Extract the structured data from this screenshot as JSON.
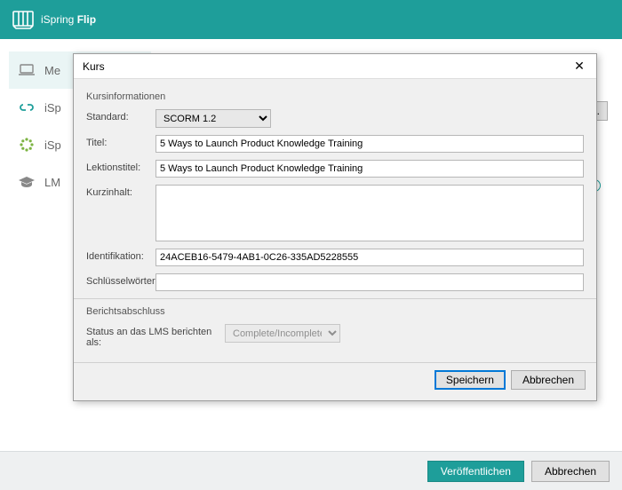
{
  "app": {
    "name": "iSpring",
    "product": "Flip"
  },
  "sidebar": {
    "tabs": [
      {
        "label": "Me"
      },
      {
        "label": "iSp"
      },
      {
        "label": "iSp"
      },
      {
        "label": "LM"
      }
    ]
  },
  "content": {
    "browse_label": "suchen...",
    "info_symbol": "i"
  },
  "modal": {
    "title": "Kurs",
    "group_info": "Kursinformationen",
    "fields": {
      "standard_label": "Standard:",
      "standard_value": "SCORM 1.2",
      "title_label": "Titel:",
      "title_value": "5 Ways to Launch Product Knowledge Training",
      "lesson_label": "Lektionstitel:",
      "lesson_value": "5 Ways to Launch Product Knowledge Training",
      "summary_label": "Kurzinhalt:",
      "summary_value": "",
      "ident_label": "Identifikation:",
      "ident_value": "24ACEB16-5479-4AB1-0C26-335AD5228555",
      "keywords_label": "Schlüsselwörter:",
      "keywords_value": ""
    },
    "group_report": "Berichtsabschluss",
    "report": {
      "label": "Status an das LMS berichten als:",
      "value": "Complete/Incomplete"
    },
    "save": "Speichern",
    "cancel": "Abbrechen"
  },
  "footer": {
    "publish": "Veröffentlichen",
    "cancel": "Abbrechen"
  }
}
